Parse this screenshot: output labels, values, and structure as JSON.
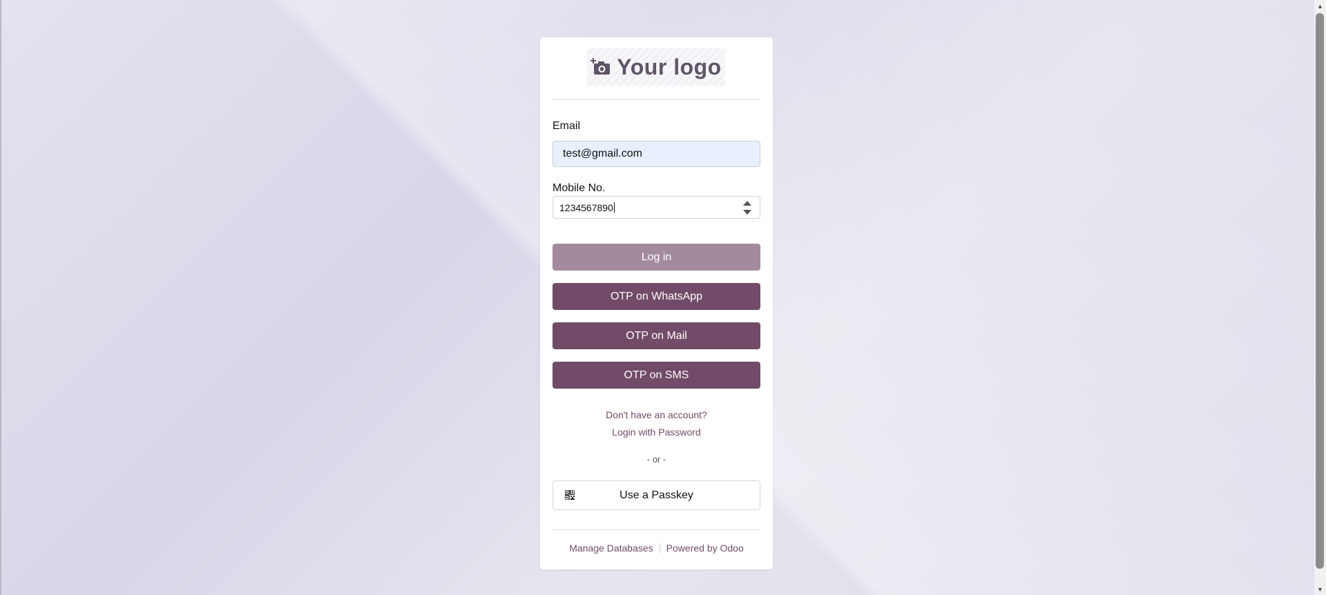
{
  "logo": {
    "text": "Your logo",
    "icon": "camera-plus-icon"
  },
  "form": {
    "email_label": "Email",
    "email_value": "test@gmail.com",
    "mobile_label": "Mobile No.",
    "mobile_value": "1234567890"
  },
  "buttons": {
    "login": "Log in",
    "otp_whatsapp": "OTP on WhatsApp",
    "otp_mail": "OTP on Mail",
    "otp_sms": "OTP on SMS",
    "passkey": "Use a Passkey"
  },
  "links": {
    "signup": "Don't have an account?",
    "login_password": "Login with Password",
    "or": "- or -"
  },
  "footer": {
    "manage_db": "Manage Databases",
    "powered": "Powered by Odoo"
  },
  "colors": {
    "brand": "#714b67",
    "brand_disabled": "#a38a9c",
    "autofill_bg": "#e8f0fe"
  }
}
